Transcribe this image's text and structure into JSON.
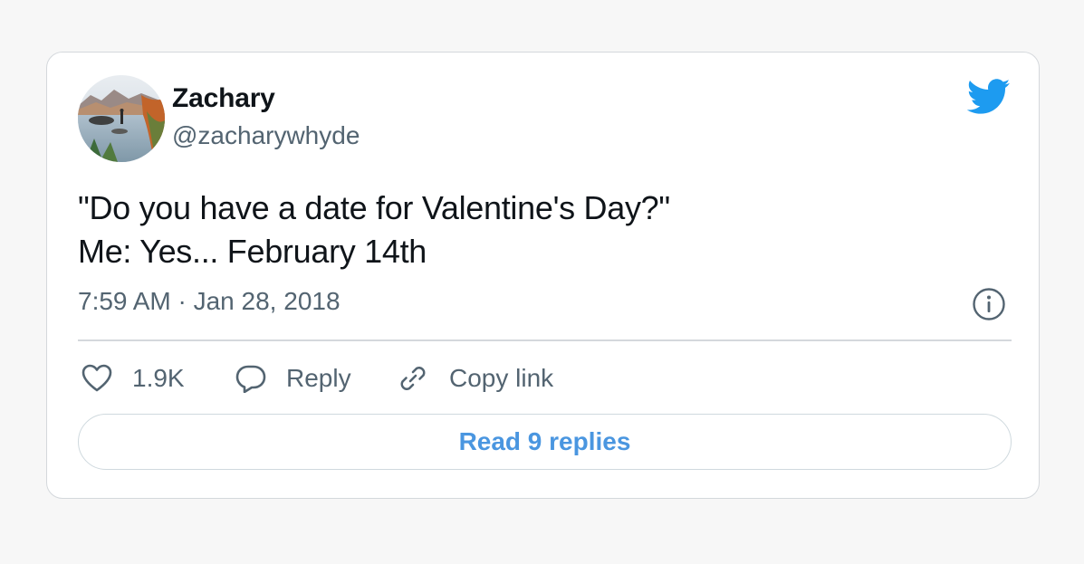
{
  "tweet": {
    "author": {
      "name": "Zachary",
      "handle": "@zacharywhyde"
    },
    "text_lines": [
      "\"Do you have a date for Valentine's Day?\"",
      "Me: Yes... February 14th"
    ],
    "timestamp": "7:59 AM · Jan 28, 2018"
  },
  "actions": {
    "like_count": "1.9K",
    "reply_label": "Reply",
    "copy_link_label": "Copy link"
  },
  "read_replies_label": "Read 9 replies",
  "icons": {
    "brand": "twitter-bird-icon",
    "info": "info-icon",
    "like": "heart-icon",
    "reply": "speech-bubble-icon",
    "copy": "link-icon"
  },
  "colors": {
    "twitter_blue": "#1d9bf0",
    "link_blue": "#4a96e0",
    "text_primary": "#0f1419",
    "text_secondary": "#536471",
    "border": "#d4d8dc"
  }
}
